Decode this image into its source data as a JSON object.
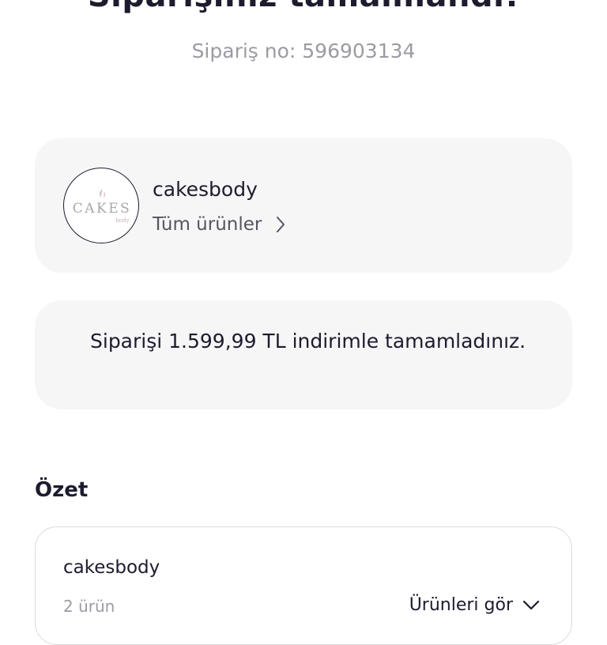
{
  "header": {
    "title": "Siparişiniz tamamlandı!",
    "order_number": "Sipariş no: 596903134"
  },
  "store": {
    "name": "cakesbody",
    "all_products_link": "Tüm ürünler",
    "logo_text": "CAKES",
    "logo_subtext": "body",
    "logo_icon": "flame-icon"
  },
  "discount": {
    "message": "Siparişi 1.599,99 TL indirimle tamamladınız."
  },
  "summary": {
    "title": "Özet",
    "store_name": "cakesbody",
    "item_count": "2 ürün",
    "see_products": "Ürünleri gör"
  },
  "colors": {
    "text_primary": "#1c1c2e",
    "text_secondary": "#9b9ba3",
    "card_background": "#f6f6f7"
  }
}
